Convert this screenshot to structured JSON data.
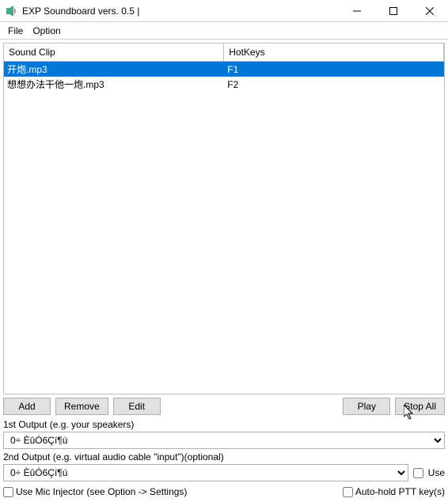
{
  "window": {
    "title": "EXP Soundboard vers. 0.5 |"
  },
  "menu": {
    "file": "File",
    "option": "Option"
  },
  "table": {
    "headers": {
      "sound": "Sound Clip",
      "hotkeys": "HotKeys"
    },
    "rows": [
      {
        "sound": "开炮.mp3",
        "hotkey": "F1",
        "selected": true
      },
      {
        "sound": "想想办法干他一炮.mp3",
        "hotkey": "F2",
        "selected": false
      }
    ]
  },
  "buttons": {
    "add": "Add",
    "remove": "Remove",
    "edit": "Edit",
    "play": "Play",
    "stopall": "Stop All"
  },
  "outputs": {
    "label1": "1st Output (e.g. your speakers)",
    "value1": "0÷ ÈûÓ6Çí¶ú",
    "label2": "2nd Output (e.g. virtual audio cable \"input\")(optional)",
    "value2": "0÷ ÈûÓ6Çí¶ú",
    "use_label": "Use"
  },
  "bottom": {
    "mic_label": "Use Mic Injector (see Option -> Settings)",
    "ptt_label": "Auto-hold PTT key(s)"
  }
}
